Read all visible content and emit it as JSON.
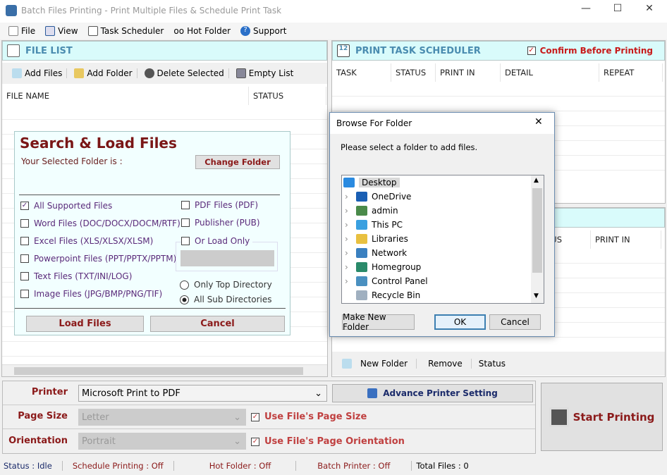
{
  "window": {
    "title": "Batch Files Printing - Print Multiple Files & Schedule Print Task",
    "minimize": "—",
    "maximize": "☐",
    "close": "✕"
  },
  "menu": [
    {
      "label": "File",
      "icon": "file-icon"
    },
    {
      "label": "View",
      "icon": "view-icon"
    },
    {
      "label": "Task Scheduler",
      "icon": "calendar-icon"
    },
    {
      "label": "Hot Folder",
      "icon": "glasses-icon"
    },
    {
      "label": "Support",
      "icon": "help-icon"
    }
  ],
  "file_list": {
    "title": "FILE LIST",
    "toolbar": [
      "Add Files",
      "Add Folder",
      "Delete Selected",
      "Empty List"
    ],
    "columns": [
      "FILE NAME",
      "STATUS"
    ]
  },
  "scheduler": {
    "title": "PRINT TASK SCHEDULER",
    "calendar_day": "12",
    "confirm_label": "Confirm Before Printing",
    "confirm_checked": true,
    "columns": [
      "TASK",
      "STATUS",
      "PRINT IN",
      "DETAIL",
      "REPEAT"
    ]
  },
  "hot_folder": {
    "columns": [
      "US",
      "PRINT IN"
    ],
    "toolbar": [
      "New Folder",
      "Remove",
      "Status"
    ]
  },
  "search": {
    "title": "Search & Load Files",
    "folder_label": "Your Selected Folder is :",
    "change_folder": "Change Folder",
    "left_options": [
      {
        "label": "All Supported Files",
        "checked": true
      },
      {
        "label": "Word Files (DOC/DOCX/DOCM/RTF)",
        "checked": false
      },
      {
        "label": "Excel Files (XLS/XLSX/XLSM)",
        "checked": false
      },
      {
        "label": "Powerpoint Files (PPT/PPTX/PPTM)",
        "checked": false
      },
      {
        "label": "Text Files (TXT/INI/LOG)",
        "checked": false
      },
      {
        "label": "Image Files (JPG/BMP/PNG/TIF)",
        "checked": false
      }
    ],
    "right_options": [
      {
        "label": "PDF Files (PDF)",
        "checked": false
      },
      {
        "label": "Publisher (PUB)",
        "checked": false
      }
    ],
    "load_only": "Or Load Only",
    "radio_top": "Only Top Directory",
    "radio_sub": "All Sub Directories",
    "radio_selected": "sub",
    "load": "Load Files",
    "cancel": "Cancel"
  },
  "dialog": {
    "title": "Browse For Folder",
    "close": "✕",
    "message": "Please select a folder to add files.",
    "items": [
      {
        "label": "Desktop",
        "selected": true,
        "icon": "desktop-icon"
      },
      {
        "label": "OneDrive",
        "icon": "cloud-icon"
      },
      {
        "label": "admin",
        "icon": "user-icon"
      },
      {
        "label": "This PC",
        "icon": "computer-icon"
      },
      {
        "label": "Libraries",
        "icon": "libraries-icon"
      },
      {
        "label": "Network",
        "icon": "network-icon"
      },
      {
        "label": "Homegroup",
        "icon": "homegroup-icon"
      },
      {
        "label": "Control Panel",
        "icon": "control-panel-icon"
      },
      {
        "label": "Recycle Bin",
        "icon": "recycle-bin-icon"
      }
    ],
    "make_new_folder": "Make New Folder",
    "ok": "OK",
    "cancel": "Cancel"
  },
  "settings": {
    "printer_label": "Printer",
    "printer_value": "Microsoft Print to PDF",
    "advance": "Advance Printer Setting",
    "page_size_label": "Page Size",
    "page_size_value": "Letter",
    "use_page_size": "Use File's Page Size",
    "orientation_label": "Orientation",
    "orientation_value": "Portrait",
    "use_orientation": "Use File's Page Orientation",
    "start": "Start Printing"
  },
  "status": {
    "status": "Status : ",
    "status_value": "Idle",
    "schedule": "Schedule Printing : Off",
    "hot": "Hot Folder : Off",
    "batch": "Batch Printer : Off",
    "total": "Total Files :  0"
  },
  "colors": {
    "header_bg": "#d9fbfb",
    "accent_red": "#8b1a1a",
    "header_text": "#4a8cb0"
  }
}
